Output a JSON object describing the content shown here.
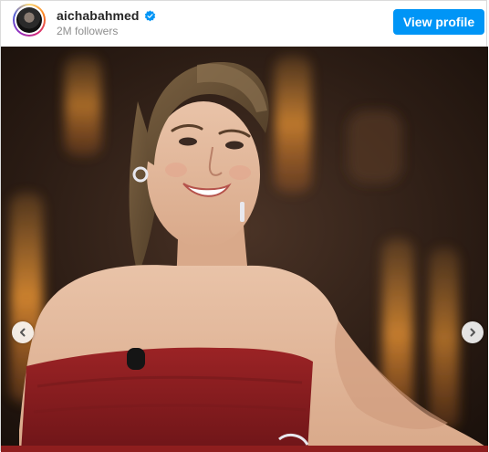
{
  "post": {
    "username": "aichabahmed",
    "followers": "2M followers",
    "view_profile_label": "View profile",
    "verified": true
  },
  "icons": {
    "verified": "verified-badge-icon",
    "prev": "chevron-left-icon",
    "next": "chevron-right-icon"
  },
  "colors": {
    "primary_button": "#0095f6",
    "verified_badge": "#0095f6",
    "dress": "#8e1e1e"
  }
}
